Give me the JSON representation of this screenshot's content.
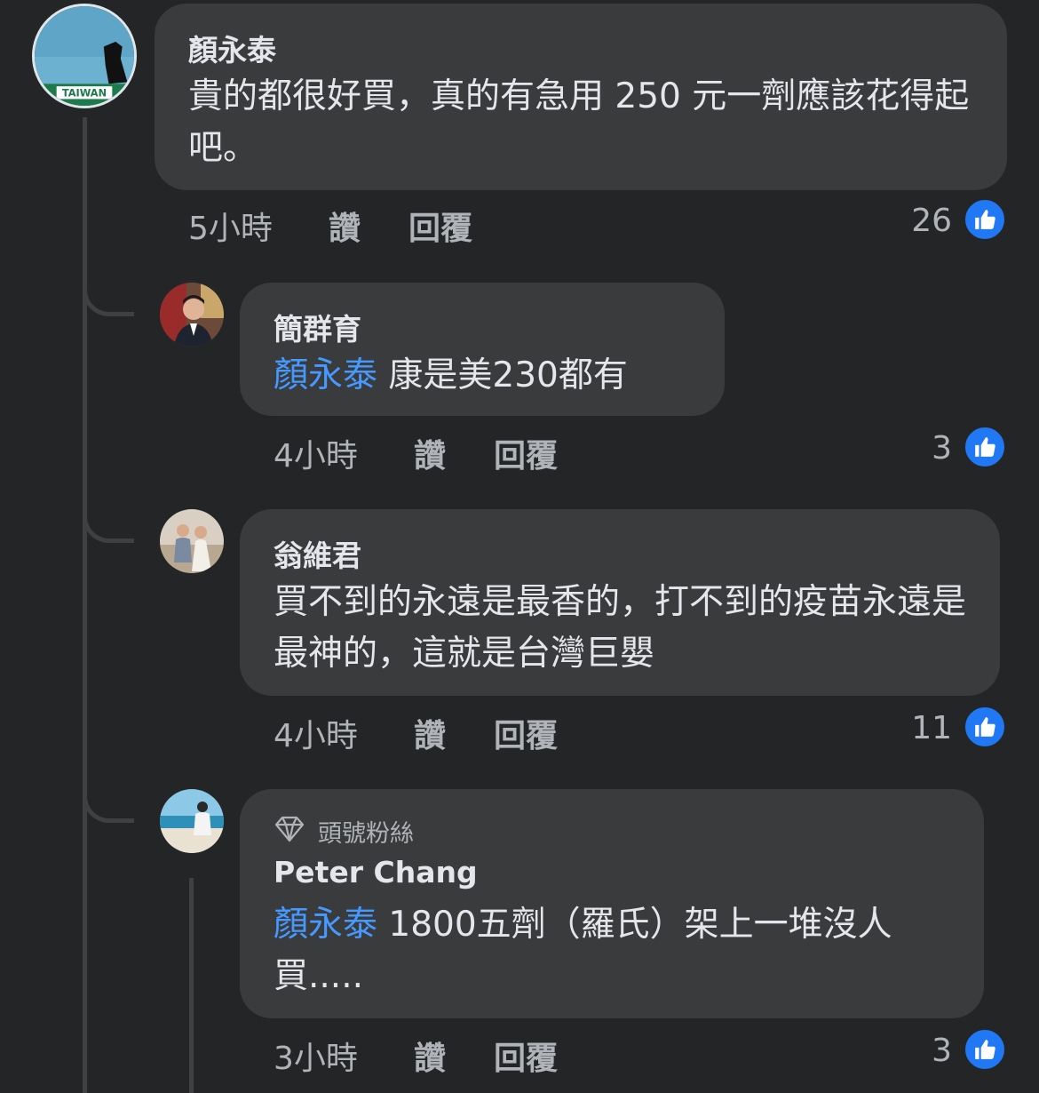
{
  "comments": [
    {
      "author": "顏永泰",
      "avatar_text": "TAIWAN",
      "text": "貴的都很好買，真的有急用 250 元一劑應該花得起吧。",
      "time": "5小時",
      "like_label": "讚",
      "reply_label": "回覆",
      "like_count": "26"
    },
    {
      "author": "簡群育",
      "mention": "顏永泰",
      "text": " 康是美230都有",
      "time": "4小時",
      "like_label": "讚",
      "reply_label": "回覆",
      "like_count": "3"
    },
    {
      "author": "翁維君",
      "text": "買不到的永遠是最香的，打不到的疫苗永遠是最神的，這就是台灣巨嬰",
      "time": "4小時",
      "like_label": "讚",
      "reply_label": "回覆",
      "like_count": "11"
    },
    {
      "badge": "頭號粉絲",
      "author": "Peter Chang",
      "mention": "顏永泰",
      "text": " 1800五劑（羅氏）架上一堆沒人買.....",
      "time": "3小時",
      "like_label": "讚",
      "reply_label": "回覆",
      "like_count": "3"
    }
  ],
  "colors": {
    "background": "#242526",
    "bubble": "#3a3b3c",
    "mention": "#4599ff",
    "like": "#2078f4",
    "meta": "#b0b3b8"
  },
  "icons": {
    "like": "thumbs-up-icon",
    "badge": "diamond-icon"
  }
}
